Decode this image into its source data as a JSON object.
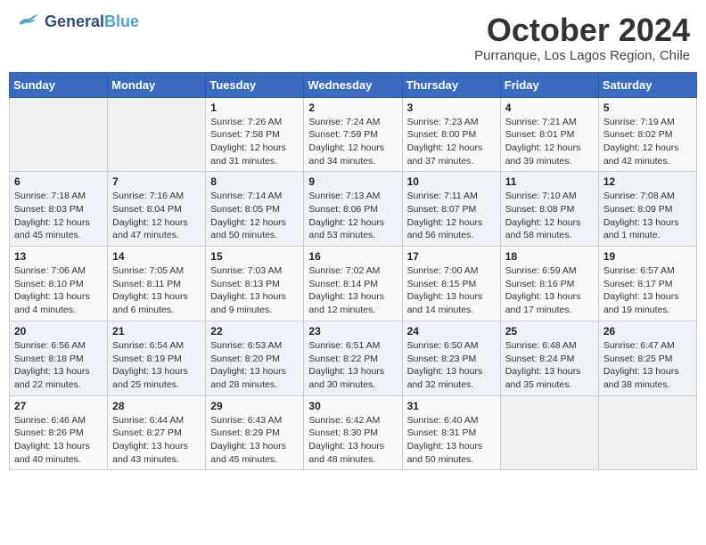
{
  "header": {
    "logo_general": "General",
    "logo_blue": "Blue",
    "month_title": "October 2024",
    "subtitle": "Purranque, Los Lagos Region, Chile"
  },
  "weekdays": [
    "Sunday",
    "Monday",
    "Tuesday",
    "Wednesday",
    "Thursday",
    "Friday",
    "Saturday"
  ],
  "weeks": [
    [
      {
        "day": "",
        "detail": ""
      },
      {
        "day": "",
        "detail": ""
      },
      {
        "day": "1",
        "detail": "Sunrise: 7:26 AM\nSunset: 7:58 PM\nDaylight: 12 hours and 31 minutes."
      },
      {
        "day": "2",
        "detail": "Sunrise: 7:24 AM\nSunset: 7:59 PM\nDaylight: 12 hours and 34 minutes."
      },
      {
        "day": "3",
        "detail": "Sunrise: 7:23 AM\nSunset: 8:00 PM\nDaylight: 12 hours and 37 minutes."
      },
      {
        "day": "4",
        "detail": "Sunrise: 7:21 AM\nSunset: 8:01 PM\nDaylight: 12 hours and 39 minutes."
      },
      {
        "day": "5",
        "detail": "Sunrise: 7:19 AM\nSunset: 8:02 PM\nDaylight: 12 hours and 42 minutes."
      }
    ],
    [
      {
        "day": "6",
        "detail": "Sunrise: 7:18 AM\nSunset: 8:03 PM\nDaylight: 12 hours and 45 minutes."
      },
      {
        "day": "7",
        "detail": "Sunrise: 7:16 AM\nSunset: 8:04 PM\nDaylight: 12 hours and 47 minutes."
      },
      {
        "day": "8",
        "detail": "Sunrise: 7:14 AM\nSunset: 8:05 PM\nDaylight: 12 hours and 50 minutes."
      },
      {
        "day": "9",
        "detail": "Sunrise: 7:13 AM\nSunset: 8:06 PM\nDaylight: 12 hours and 53 minutes."
      },
      {
        "day": "10",
        "detail": "Sunrise: 7:11 AM\nSunset: 8:07 PM\nDaylight: 12 hours and 56 minutes."
      },
      {
        "day": "11",
        "detail": "Sunrise: 7:10 AM\nSunset: 8:08 PM\nDaylight: 12 hours and 58 minutes."
      },
      {
        "day": "12",
        "detail": "Sunrise: 7:08 AM\nSunset: 8:09 PM\nDaylight: 13 hours and 1 minute."
      }
    ],
    [
      {
        "day": "13",
        "detail": "Sunrise: 7:06 AM\nSunset: 8:10 PM\nDaylight: 13 hours and 4 minutes."
      },
      {
        "day": "14",
        "detail": "Sunrise: 7:05 AM\nSunset: 8:11 PM\nDaylight: 13 hours and 6 minutes."
      },
      {
        "day": "15",
        "detail": "Sunrise: 7:03 AM\nSunset: 8:13 PM\nDaylight: 13 hours and 9 minutes."
      },
      {
        "day": "16",
        "detail": "Sunrise: 7:02 AM\nSunset: 8:14 PM\nDaylight: 13 hours and 12 minutes."
      },
      {
        "day": "17",
        "detail": "Sunrise: 7:00 AM\nSunset: 8:15 PM\nDaylight: 13 hours and 14 minutes."
      },
      {
        "day": "18",
        "detail": "Sunrise: 6:59 AM\nSunset: 8:16 PM\nDaylight: 13 hours and 17 minutes."
      },
      {
        "day": "19",
        "detail": "Sunrise: 6:57 AM\nSunset: 8:17 PM\nDaylight: 13 hours and 19 minutes."
      }
    ],
    [
      {
        "day": "20",
        "detail": "Sunrise: 6:56 AM\nSunset: 8:18 PM\nDaylight: 13 hours and 22 minutes."
      },
      {
        "day": "21",
        "detail": "Sunrise: 6:54 AM\nSunset: 8:19 PM\nDaylight: 13 hours and 25 minutes."
      },
      {
        "day": "22",
        "detail": "Sunrise: 6:53 AM\nSunset: 8:20 PM\nDaylight: 13 hours and 28 minutes."
      },
      {
        "day": "23",
        "detail": "Sunrise: 6:51 AM\nSunset: 8:22 PM\nDaylight: 13 hours and 30 minutes."
      },
      {
        "day": "24",
        "detail": "Sunrise: 6:50 AM\nSunset: 8:23 PM\nDaylight: 13 hours and 32 minutes."
      },
      {
        "day": "25",
        "detail": "Sunrise: 6:48 AM\nSunset: 8:24 PM\nDaylight: 13 hours and 35 minutes."
      },
      {
        "day": "26",
        "detail": "Sunrise: 6:47 AM\nSunset: 8:25 PM\nDaylight: 13 hours and 38 minutes."
      }
    ],
    [
      {
        "day": "27",
        "detail": "Sunrise: 6:46 AM\nSunset: 8:26 PM\nDaylight: 13 hours and 40 minutes."
      },
      {
        "day": "28",
        "detail": "Sunrise: 6:44 AM\nSunset: 8:27 PM\nDaylight: 13 hours and 43 minutes."
      },
      {
        "day": "29",
        "detail": "Sunrise: 6:43 AM\nSunset: 8:29 PM\nDaylight: 13 hours and 45 minutes."
      },
      {
        "day": "30",
        "detail": "Sunrise: 6:42 AM\nSunset: 8:30 PM\nDaylight: 13 hours and 48 minutes."
      },
      {
        "day": "31",
        "detail": "Sunrise: 6:40 AM\nSunset: 8:31 PM\nDaylight: 13 hours and 50 minutes."
      },
      {
        "day": "",
        "detail": ""
      },
      {
        "day": "",
        "detail": ""
      }
    ]
  ]
}
